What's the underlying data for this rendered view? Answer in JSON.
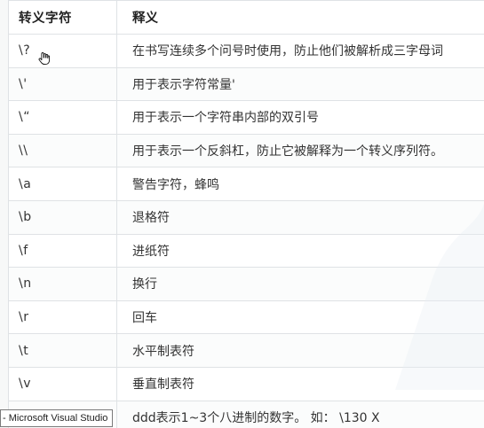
{
  "table": {
    "headers": [
      "转义字符",
      "释义"
    ],
    "rows": [
      {
        "code": "\\?",
        "meaning": "在书写连续多个问号时使用，防止他们被解析成三字母词"
      },
      {
        "code": "\\'",
        "meaning": "用于表示字符常量'"
      },
      {
        "code": "\\“",
        "meaning": "用于表示一个字符串内部的双引号"
      },
      {
        "code": "\\\\",
        "meaning": "用于表示一个反斜杠，防止它被解释为一个转义序列符。"
      },
      {
        "code": "\\a",
        "meaning": "警告字符，蜂鸣"
      },
      {
        "code": "\\b",
        "meaning": "退格符"
      },
      {
        "code": "\\f",
        "meaning": "进纸符"
      },
      {
        "code": "\\n",
        "meaning": "换行"
      },
      {
        "code": "\\r",
        "meaning": "回车"
      },
      {
        "code": "\\t",
        "meaning": "水平制表符"
      },
      {
        "code": "\\v",
        "meaning": "垂直制表符"
      },
      {
        "code": "",
        "meaning": "ddd表示1~3个八进制的数字。 如： \\130 X"
      }
    ]
  },
  "taskbar": {
    "tooltip": "- Microsoft Visual Studio"
  },
  "cursor": {
    "icon": "hand-pointer-icon"
  },
  "colors": {
    "border": "#dfe2e5",
    "text": "#333333",
    "background": "#ffffff"
  }
}
